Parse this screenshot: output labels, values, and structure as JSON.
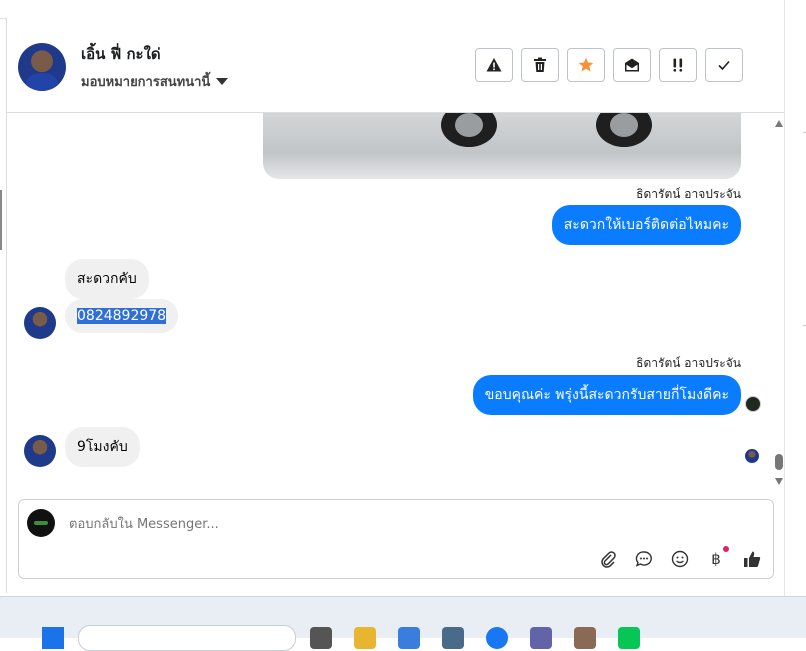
{
  "header": {
    "contact_name": "เอิ้น ฟี่ กะใด่",
    "assign_label": "มอบหมายการสนทนานี้",
    "actions": [
      {
        "name": "report-spam",
        "icon": "warning-icon"
      },
      {
        "name": "delete",
        "icon": "trash-icon"
      },
      {
        "name": "star",
        "icon": "star-icon"
      },
      {
        "name": "mark-unread",
        "icon": "envelope-open-icon"
      },
      {
        "name": "follow-up",
        "icon": "double-exclamation-icon"
      },
      {
        "name": "mark-done",
        "icon": "check-icon"
      }
    ]
  },
  "messages": {
    "sender_1": "ธิดารัตน์ อาจประจัน",
    "out_1": "สะดวกให้เบอร์ติดต่อไหมคะ",
    "in_1": "สะดวกคับ",
    "in_2": "0824892978",
    "sender_2": "ธิดารัตน์ อาจประจัน",
    "out_2": "ขอบคุณค่ะ พรุ่งนี้สะดวกรับสายกี่โมงดีคะ",
    "in_3": "9โมงคับ"
  },
  "composer": {
    "placeholder": "ตอบกลับใน Messenger..."
  },
  "colors": {
    "outgoing_bubble": "#0a7cff",
    "incoming_bubble": "#f0f0f0",
    "star_accent": "#f7923a",
    "selection": "#2f6fd6"
  }
}
